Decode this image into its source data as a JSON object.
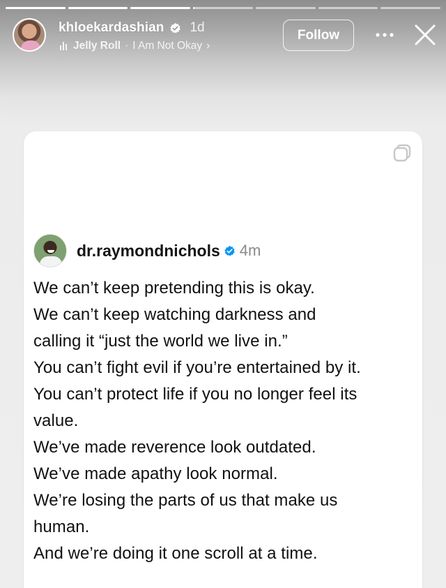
{
  "story": {
    "progress": [
      1,
      1,
      1,
      0.02,
      0,
      0,
      0
    ],
    "progress_colors": {
      "filled": "#ffffff",
      "track": "rgba(255,255,255,0.55)"
    }
  },
  "header": {
    "username": "khloekardashian",
    "verified_icon": "verified-badge-icon",
    "time": "1d",
    "music": {
      "icon": "music-bars-icon",
      "artist": "Jelly Roll",
      "separator": "·",
      "song": "I Am Not Okay",
      "chevron": "›"
    },
    "follow_label": "Follow",
    "more_icon": "more-dots-icon",
    "close_icon": "close-icon"
  },
  "post": {
    "copy_icon": "copy-icon",
    "username": "dr.raymondnichols",
    "verified_color": "#0095f6",
    "time": "4m",
    "lines": [
      "We can’t keep pretending this is okay.",
      "We can’t keep watching darkness and",
      "calling it “just the world we live in.”",
      "You can’t fight evil if you’re entertained by it.",
      "You can’t protect life if you no longer feel its",
      "value.",
      "We’ve made reverence look outdated.",
      "We’ve made apathy look normal.",
      "We’re losing the parts of us that make us",
      "human.",
      "And we’re doing it one scroll at a time."
    ]
  }
}
